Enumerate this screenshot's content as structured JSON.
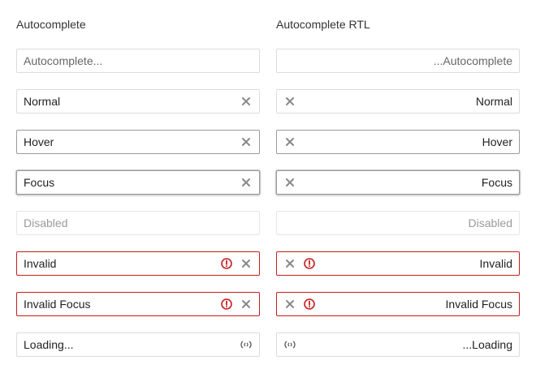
{
  "colors": {
    "invalid": "#c41e1e",
    "icon": "#888888"
  },
  "ltr": {
    "heading": "Autocomplete",
    "placeholder": "Autocomplete...",
    "normal": "Normal",
    "hover": "Hover",
    "focus": "Focus",
    "disabled": "Disabled",
    "invalid": "Invalid",
    "invalid_focus": "Invalid Focus",
    "loading": "Loading..."
  },
  "rtl": {
    "heading": "Autocomplete RTL",
    "placeholder": "...Autocomplete",
    "normal": "Normal",
    "hover": "Hover",
    "focus": "Focus",
    "disabled": "Disabled",
    "invalid": "Invalid",
    "invalid_focus": "Invalid Focus",
    "loading": "...Loading"
  },
  "icons": {
    "clear": "close-icon",
    "error": "error-icon",
    "loading": "loading-icon"
  }
}
